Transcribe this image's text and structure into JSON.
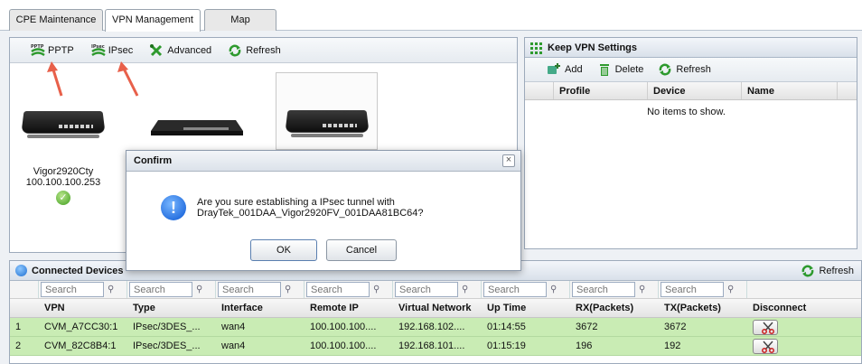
{
  "tabs": [
    {
      "label": "CPE Maintenance"
    },
    {
      "label": "VPN Management"
    },
    {
      "label": "Map"
    }
  ],
  "vpn_toolbar": {
    "pptp": "PPTP",
    "pptp_badge": "PPTP",
    "ipsec": "IPsec",
    "ipsec_badge": "IPsec",
    "advanced": "Advanced",
    "refresh": "Refresh"
  },
  "devices": [
    {
      "name": "Vigor2920Cty",
      "ip": "100.100.100.253",
      "status": "online"
    }
  ],
  "keep_vpn": {
    "title": "Keep VPN Settings",
    "add": "Add",
    "delete": "Delete",
    "refresh": "Refresh",
    "columns": [
      "Profile",
      "Device",
      "Name"
    ],
    "empty_text": "No items to show."
  },
  "connected": {
    "title": "Connected Devices",
    "refresh": "Refresh",
    "search_placeholder": "Search",
    "columns": [
      "VPN",
      "Type",
      "Interface",
      "Remote IP",
      "Virtual Network",
      "Up Time",
      "RX(Packets)",
      "TX(Packets)",
      "Disconnect"
    ],
    "rows": [
      {
        "num": "1",
        "vpn": "CVM_A7CC30:1",
        "type": "IPsec/3DES_...",
        "interface": "wan4",
        "remote_ip": "100.100.100....",
        "virtual_network": "192.168.102....",
        "up_time": "01:14:55",
        "rx": "3672",
        "tx": "3672"
      },
      {
        "num": "2",
        "vpn": "CVM_82C8B4:1",
        "type": "IPsec/3DES_...",
        "interface": "wan4",
        "remote_ip": "100.100.100....",
        "virtual_network": "192.168.101....",
        "up_time": "01:15:19",
        "rx": "196",
        "tx": "192"
      }
    ]
  },
  "dialog": {
    "title": "Confirm",
    "line1": "Are you sure establishing a IPsec tunnel with",
    "line2": "DrayTek_001DAA_Vigor2920FV_001DAA81BC64?",
    "ok": "OK",
    "cancel": "Cancel"
  },
  "colors": {
    "row_green": "#c9ecb4",
    "toolbar_green": "#2e9a2e",
    "annotation_arrow": "#e8604a"
  }
}
